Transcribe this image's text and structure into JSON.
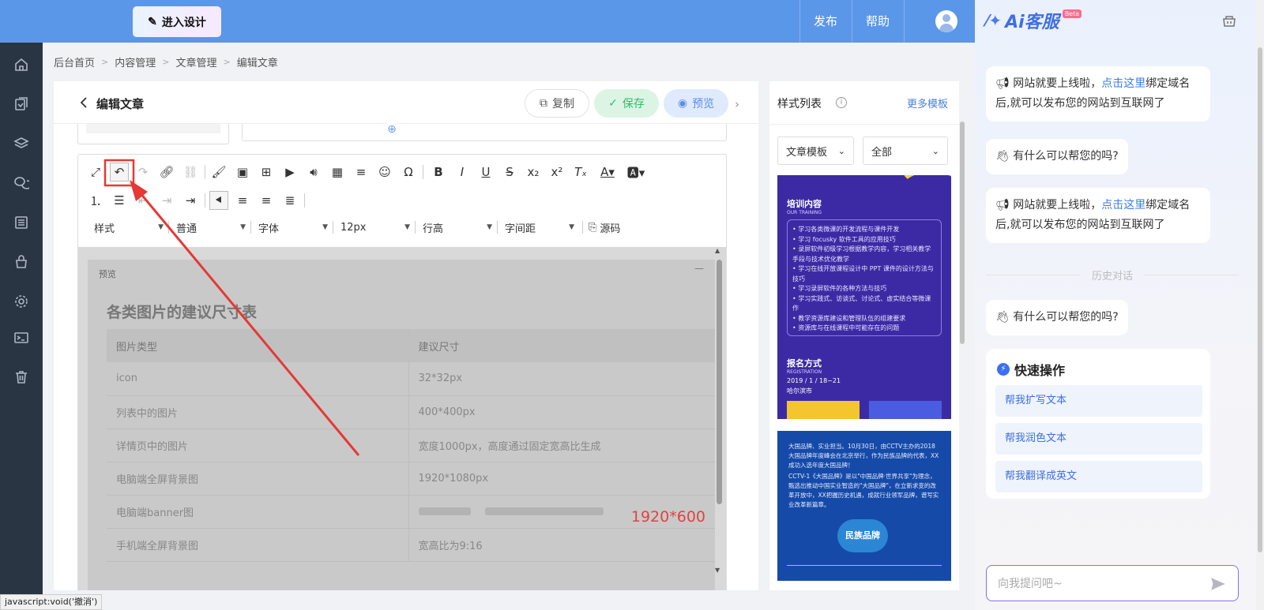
{
  "header": {
    "design_button": "进入设计",
    "publish": "发布",
    "help": "帮助"
  },
  "sidebar": {
    "icons": [
      "home-icon",
      "pages-icon",
      "layers-icon",
      "chat-icon",
      "list-icon",
      "shop-icon",
      "settings-icon",
      "terminal-icon",
      "trash-icon"
    ]
  },
  "breadcrumb": [
    "后台首页",
    "内容管理",
    "文章管理",
    "编辑文章"
  ],
  "editor": {
    "title": "编辑文章",
    "copy": "复制",
    "save": "保存",
    "preview": "预览",
    "selects": [
      "样式",
      "普通",
      "字体",
      "12px",
      "行高",
      "字间距"
    ],
    "source": "源码",
    "preview_label": "预览",
    "heading": "各类图片的建议尺寸表",
    "table": {
      "headers": [
        "图片类型",
        "建议尺寸"
      ],
      "rows": [
        [
          "icon",
          "32*32px"
        ],
        [
          "列表中的图片",
          "400*400px"
        ],
        [
          "详情页中的图片",
          "宽度1000px，高度通过固定宽高比生成"
        ],
        [
          "电脑端全屏背景图",
          "1920*1080px"
        ],
        [
          "电脑端banner图",
          ""
        ],
        [
          "手机端全屏背景图",
          "宽高比为9:16"
        ]
      ]
    },
    "banner_size": "1920*600"
  },
  "style_panel": {
    "title": "样式列表",
    "more": "更多模板",
    "filter_type": "文章模板",
    "filter_scope": "全部",
    "tpl1": {
      "head": "培训内容",
      "sub": "OUR TRAINING",
      "items": [
        "• 学习各类微课的开发流程与课件开发",
        "• 学习 focusky 软件工具的应用技巧",
        "• 录屏软件初级学习根据教学内容，学习相关教学手段与技术优化教学",
        "• 学习在线开放课程设计中 PPT 课件的设计方法与技巧",
        "• 学习录屏软件的各种方法与技巧",
        "• 学习实践式、访谈式、讨论式、虚实结合等微课作",
        "• 教学资源库建设和管理队伍的组建要求",
        "• 资源库与在线课程中可能存在的问题"
      ],
      "head2": "报名方式",
      "sub2": "REGISTRATION",
      "date": "2019 / 1 / 18~21",
      "location": "哈尔滨市"
    },
    "tpl2": {
      "p1": "大国品牌、实业担当。10月30日，由CCTV主办的2018大国品牌年度峰会在北京举行，作为民族品牌的代表，XX成功入选年度大国品牌！",
      "p2": "CCTV-1《大国品牌》是以\"中国品牌·世界共享\"为理念，甄选出推动中国实业智造的\"大国品牌\"，在立新求变的改革开放中，XX把握历史机遇，成就行业领军品牌，谱写实业改革新篇章。",
      "badge": "民族品牌"
    }
  },
  "ai_panel": {
    "brand": "Ai客服",
    "beta": "Beta",
    "msg1_prefix": "网站就要上线啦，",
    "msg1_link": "点击这里",
    "msg1_suffix": "绑定域名后,就可以发布您的网站到互联网了",
    "msg2": "有什么可以帮您的吗?",
    "msg3_prefix": "网站就要上线啦，",
    "msg3_link": "点击这里",
    "msg3_suffix": "绑定域名后,就可以发布您的网站到互联网了",
    "history": "历史对话",
    "msg4": "有什么可以帮您的吗?",
    "quick_title": "快速操作",
    "quick_actions": [
      "帮我扩写文本",
      "帮我润色文本",
      "帮我翻译成英文"
    ],
    "input_placeholder": "向我提问吧~"
  },
  "status_bar": "javascript:void('撤消')",
  "colors": {
    "header": "#5b97e9",
    "sidebar": "#2a3544",
    "accent_blue": "#3d7de8",
    "save_green": "#2ebd69",
    "annotation_red": "#e53935"
  }
}
